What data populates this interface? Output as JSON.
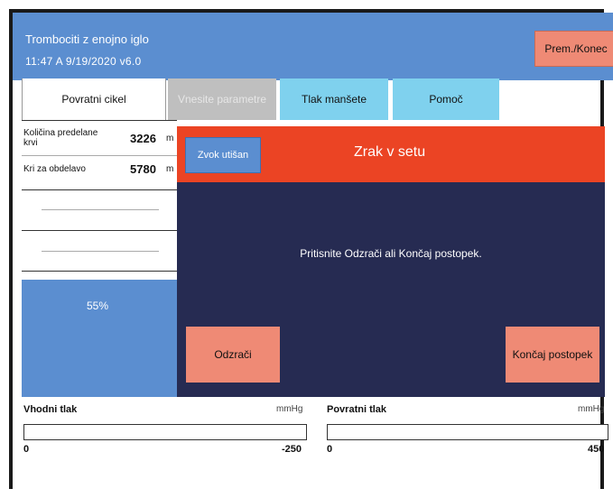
{
  "header": {
    "title": "Trombociti z enojno iglo",
    "subtitle": "11:47 A  9/19/2020   v6.0",
    "exit_button": "Prem./Konec"
  },
  "tabs": [
    {
      "label": "Povratni cikel",
      "state": "active"
    },
    {
      "label": "Vnesite parametre",
      "state": "disabled"
    },
    {
      "label": "Tlak manšete",
      "state": "normal"
    },
    {
      "label": "Pomoč",
      "state": "normal"
    }
  ],
  "stats": {
    "processed_label": "Količina predelane krvi",
    "processed_value": "3226",
    "processed_unit": "m",
    "to_process_label": "Kri za obdelavo",
    "to_process_value": "5780",
    "to_process_unit": "m"
  },
  "progress": {
    "label": "55%",
    "value": 55
  },
  "alarm": {
    "mute_button": "Zvok utišan",
    "title": "Zrak v setu",
    "message": "Pritisnite Odzrači ali Končaj postopek.",
    "vent_button": "Odzrači",
    "end_button": "Končaj postopek"
  },
  "pressure": {
    "inlet": {
      "label": "Vhodni tlak",
      "unit": "mmHg",
      "min": "0",
      "max": "-250"
    },
    "return": {
      "label": "Povratni tlak",
      "unit": "mmHg",
      "min": "0",
      "max": "450"
    }
  },
  "colors": {
    "header_blue": "#5b8ed0",
    "alarm_red": "#eb4424",
    "alarm_navy": "#262b52",
    "button_salmon": "#ef8a75",
    "tab_cyan": "#7fd1ee"
  }
}
